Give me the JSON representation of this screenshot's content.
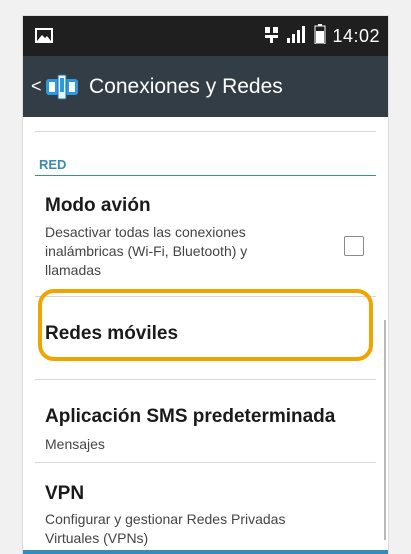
{
  "status_bar": {
    "time": "14:02",
    "icons": [
      "image-notification-icon",
      "sim-icon",
      "signal-icon",
      "battery-icon"
    ]
  },
  "action_bar": {
    "back": "<",
    "title": "Conexiones y Redes",
    "icon": "network-settings-icon"
  },
  "section": {
    "header": "RED"
  },
  "items": [
    {
      "title": "Modo avión",
      "subtitle": "Desactivar todas las conexiones inalámbricas (Wi-Fi, Bluetooth) y llamadas",
      "checkbox": false
    },
    {
      "title": "Redes móviles",
      "subtitle": ""
    },
    {
      "title": "Aplicación SMS predeterminada",
      "subtitle": "Mensajes"
    },
    {
      "title": "VPN",
      "subtitle": "Configurar y gestionar Redes Privadas Virtuales (VPNs)"
    }
  ],
  "colors": {
    "action_bar": "#333d46",
    "status_bar": "#1f1f1f",
    "accent": "#3a8ab8",
    "highlight": "#f0a400"
  }
}
